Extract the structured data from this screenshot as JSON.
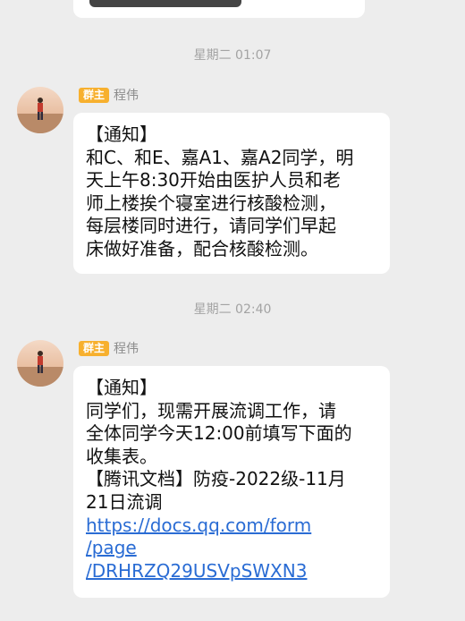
{
  "messages": [
    {
      "timestamp": "星期二 01:07",
      "role_badge": "群主",
      "sender": "程伟",
      "lines": [
        "【通知】",
        "和C、和E、嘉A1、嘉A2同学，明",
        "天上午8:30开始由医护人员和老",
        "师上楼挨个寝室进行核酸检测，",
        "每层楼同时进行，请同学们早起",
        "床做好准备，配合核酸检测。"
      ]
    },
    {
      "timestamp": "星期二 02:40",
      "role_badge": "群主",
      "sender": "程伟",
      "lines": [
        "【通知】",
        "同学们，现需开展流调工作，请",
        "全体同学今天12:00前填写下面的",
        "收集表。",
        "【腾讯文档】防疫-2022级-11月",
        "21日流调"
      ],
      "link_lines": [
        "https://docs.qq.com/form",
        "/page",
        "/DRHRZQ29USVpSWXN3"
      ]
    }
  ]
}
